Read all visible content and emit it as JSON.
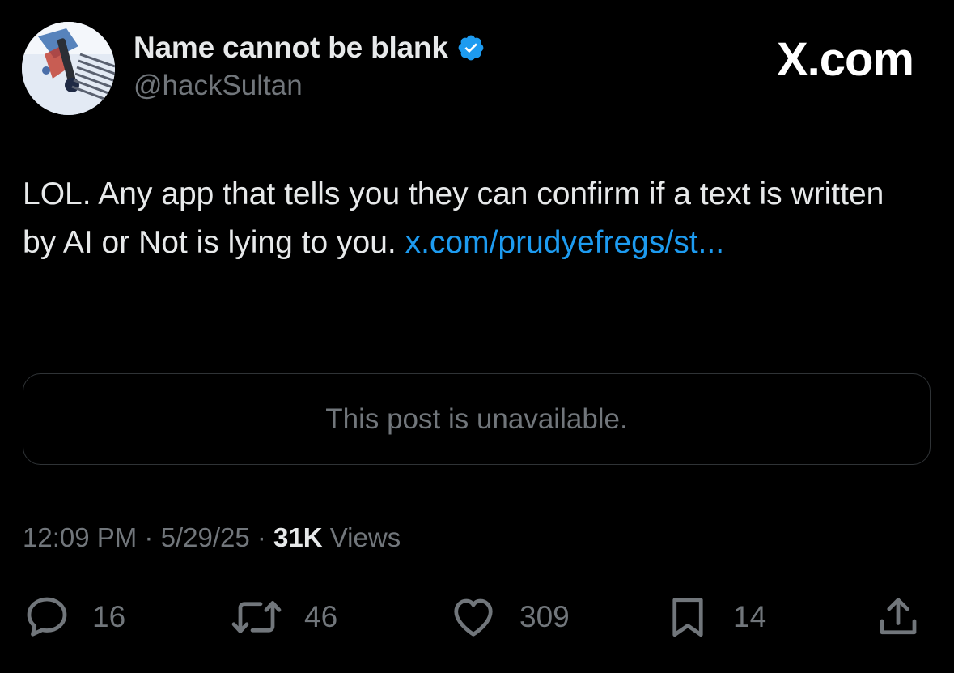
{
  "author": {
    "name": "Name cannot be blank",
    "handle": "@hackSultan",
    "verified": true
  },
  "brand": "X.com",
  "post": {
    "text": "LOL. Any app that tells you they can confirm if a text is written by AI or Not is lying to you. ",
    "link_text": "x.com/prudyefregs/st..."
  },
  "quoted_post": {
    "message": "This post is unavailable."
  },
  "meta": {
    "time": "12:09 PM",
    "separator": "·",
    "date": "5/29/25",
    "views_count": "31K",
    "views_label": "Views"
  },
  "actions": {
    "replies": "16",
    "reposts": "46",
    "likes": "309",
    "bookmarks": "14"
  },
  "colors": {
    "background": "#000000",
    "primary_text": "#e7e9ea",
    "secondary_text": "#71767b",
    "link": "#1d9bf0",
    "verified_badge": "#1d9bf0",
    "border": "#2f3336"
  },
  "icons": {
    "reply": "speech-bubble-icon",
    "repost": "repost-arrows-icon",
    "like": "heart-icon",
    "bookmark": "bookmark-icon",
    "share": "share-upload-icon",
    "verified": "verified-badge-icon"
  }
}
